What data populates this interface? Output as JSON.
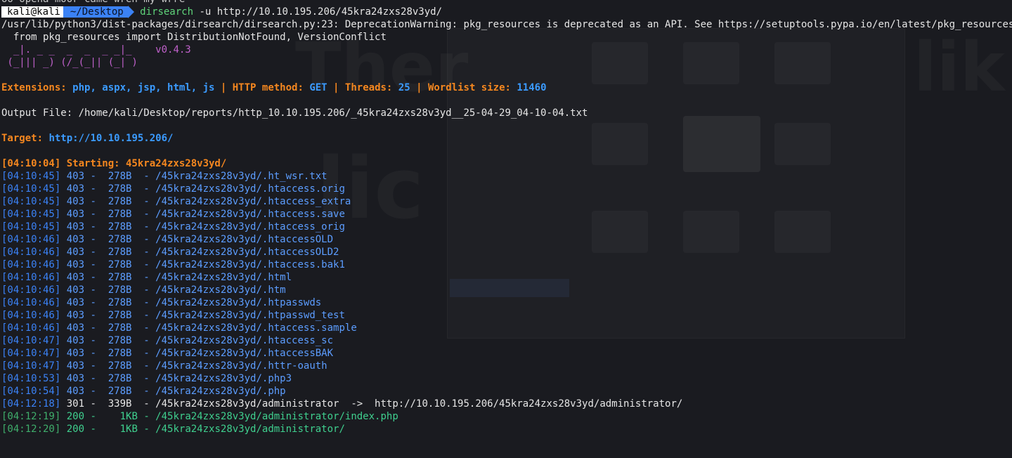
{
  "terminal": {
    "partial_top_line": "oo opena moor came wren my wrre",
    "prompt": {
      "user": "kali@kali",
      "dir": "~/Desktop",
      "command": "dirsearch",
      "args": " -u http://10.10.195.206/45kra24zxs28v3yd/"
    },
    "warning_line1": "/usr/lib/python3/dist-packages/dirsearch/dirsearch.py:23: DeprecationWarning: pkg_resources is deprecated as an API. See https://setuptools.pypa.io/en/latest/pkg_resources.html",
    "warning_line2": "  from pkg_resources import DistributionNotFound, VersionConflict",
    "logo_line1": "  _|. _ _  _  _  _ _|_    ",
    "logo_line2": " (_||| _) (/_(_|| (_| )   ",
    "version": "v0.4.3",
    "config": {
      "ext_label": "Extensions: ",
      "ext_value": "php, aspx, jsp, html, js",
      "sep": " | ",
      "method_label": "HTTP method: ",
      "method_value": "GET",
      "threads_label": "Threads: ",
      "threads_value": "25",
      "wordlist_label": "Wordlist size: ",
      "wordlist_value": "11460"
    },
    "output_file": "Output File: /home/kali/Desktop/reports/http_10.10.195.206/_45kra24zxs28v3yd__25-04-29_04-10-04.txt",
    "target_label": "Target: ",
    "target_value": "http://10.10.195.206/",
    "starting": "[04:10:04] Starting: 45kra24zxs28v3yd/",
    "results": [
      {
        "ts": "[04:10:45]",
        "code": " 403 -  ",
        "size": "278B",
        "path": "  - /45kra24zxs28v3yd/.ht_wsr.txt",
        "status": "403"
      },
      {
        "ts": "[04:10:45]",
        "code": " 403 -  ",
        "size": "278B",
        "path": "  - /45kra24zxs28v3yd/.htaccess.orig",
        "status": "403"
      },
      {
        "ts": "[04:10:45]",
        "code": " 403 -  ",
        "size": "278B",
        "path": "  - /45kra24zxs28v3yd/.htaccess_extra",
        "status": "403"
      },
      {
        "ts": "[04:10:45]",
        "code": " 403 -  ",
        "size": "278B",
        "path": "  - /45kra24zxs28v3yd/.htaccess.save",
        "status": "403"
      },
      {
        "ts": "[04:10:45]",
        "code": " 403 -  ",
        "size": "278B",
        "path": "  - /45kra24zxs28v3yd/.htaccess_orig",
        "status": "403"
      },
      {
        "ts": "[04:10:46]",
        "code": " 403 -  ",
        "size": "278B",
        "path": "  - /45kra24zxs28v3yd/.htaccessOLD",
        "status": "403"
      },
      {
        "ts": "[04:10:46]",
        "code": " 403 -  ",
        "size": "278B",
        "path": "  - /45kra24zxs28v3yd/.htaccessOLD2",
        "status": "403"
      },
      {
        "ts": "[04:10:46]",
        "code": " 403 -  ",
        "size": "278B",
        "path": "  - /45kra24zxs28v3yd/.htaccess.bak1",
        "status": "403"
      },
      {
        "ts": "[04:10:46]",
        "code": " 403 -  ",
        "size": "278B",
        "path": "  - /45kra24zxs28v3yd/.html",
        "status": "403"
      },
      {
        "ts": "[04:10:46]",
        "code": " 403 -  ",
        "size": "278B",
        "path": "  - /45kra24zxs28v3yd/.htm",
        "status": "403"
      },
      {
        "ts": "[04:10:46]",
        "code": " 403 -  ",
        "size": "278B",
        "path": "  - /45kra24zxs28v3yd/.htpasswds",
        "status": "403"
      },
      {
        "ts": "[04:10:46]",
        "code": " 403 -  ",
        "size": "278B",
        "path": "  - /45kra24zxs28v3yd/.htpasswd_test",
        "status": "403"
      },
      {
        "ts": "[04:10:46]",
        "code": " 403 -  ",
        "size": "278B",
        "path": "  - /45kra24zxs28v3yd/.htaccess.sample",
        "status": "403"
      },
      {
        "ts": "[04:10:47]",
        "code": " 403 -  ",
        "size": "278B",
        "path": "  - /45kra24zxs28v3yd/.htaccess_sc",
        "status": "403"
      },
      {
        "ts": "[04:10:47]",
        "code": " 403 -  ",
        "size": "278B",
        "path": "  - /45kra24zxs28v3yd/.htaccessBAK",
        "status": "403"
      },
      {
        "ts": "[04:10:47]",
        "code": " 403 -  ",
        "size": "278B",
        "path": "  - /45kra24zxs28v3yd/.httr-oauth",
        "status": "403"
      },
      {
        "ts": "[04:10:53]",
        "code": " 403 -  ",
        "size": "278B",
        "path": "  - /45kra24zxs28v3yd/.php3",
        "status": "403"
      },
      {
        "ts": "[04:10:54]",
        "code": " 403 -  ",
        "size": "278B",
        "path": "  - /45kra24zxs28v3yd/.php",
        "status": "403"
      },
      {
        "ts": "[04:12:18]",
        "code": " 301 -  ",
        "size": "339B",
        "path": "  - /45kra24zxs28v3yd/administrator  ->  http://10.10.195.206/45kra24zxs28v3yd/administrator/",
        "status": "301"
      },
      {
        "ts": "[04:12:19]",
        "code": " 200 -  ",
        "size": "  1KB",
        "path": " - /45kra24zxs28v3yd/administrator/index.php",
        "status": "200"
      },
      {
        "ts": "[04:12:20]",
        "code": " 200 -  ",
        "size": "  1KB",
        "path": " - /45kra24zxs28v3yd/administrator/",
        "status": "200"
      }
    ]
  }
}
